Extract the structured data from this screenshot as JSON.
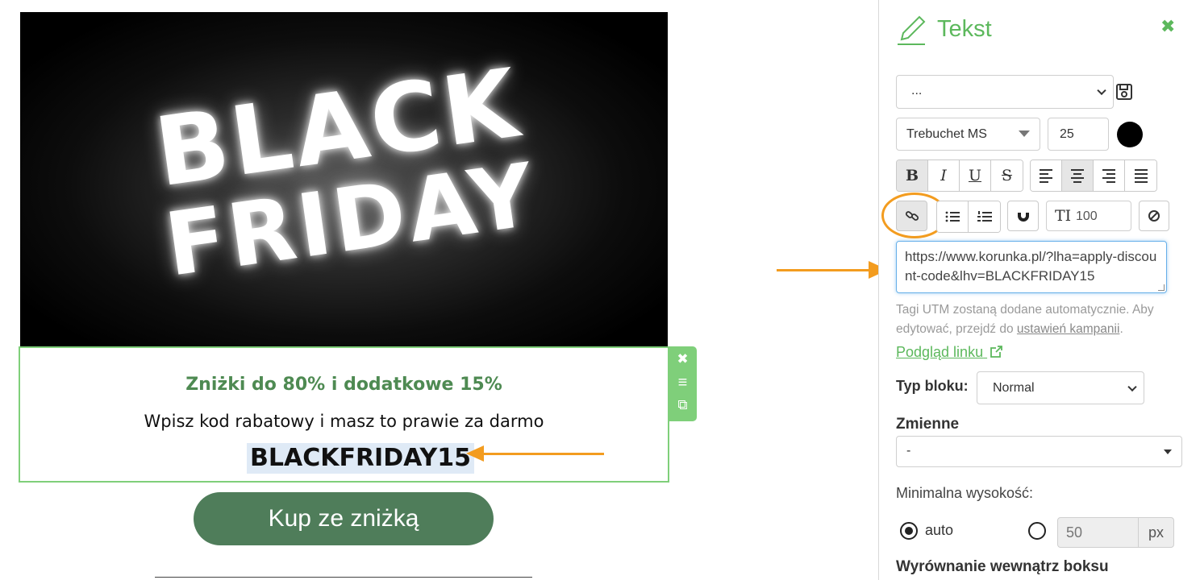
{
  "canvas": {
    "hero": {
      "line1": "BLACK",
      "line2": "FRIDAY"
    },
    "text_block": {
      "heading": "Zniżki do 80% i dodatkowe 15%",
      "subheading": "Wpisz kod rabatowy i masz to prawie za darmo",
      "code": "BLACKFRIDAY15"
    },
    "block_tools": {
      "close": "✖",
      "move": "≡",
      "duplicate": "⧉"
    },
    "cta_label": "Kup ze zniżką"
  },
  "panel": {
    "title": "Tekst",
    "close": "✖",
    "style_select": "...",
    "font_family": "Trebuchet MS",
    "font_size": "25",
    "text_color": "#000000",
    "format_buttons": {
      "bold": "B",
      "italic": "I",
      "underline": "U",
      "strike": "S"
    },
    "line_height_icon": "TI",
    "line_height": "100",
    "link_url": "https://www.korunka.pl/?lha=apply-discount-code&lhv=BLACKFRIDAY15",
    "utm_note_prefix": "Tagi UTM zostaną dodane automatycznie. Aby edytować, przejdź do ",
    "utm_note_link": "ustawień kampanii",
    "utm_note_suffix": ".",
    "preview_link": "Podgląd linku",
    "block_type_label": "Typ bloku:",
    "block_type_value": "Normal",
    "variables_label": "Zmienne",
    "variables_value": "-",
    "min_height_label": "Minimalna wysokość:",
    "min_height_auto": "auto",
    "min_height_value": "50",
    "min_height_unit": "px",
    "inner_align_label": "Wyrównanie wewnątrz boksu"
  },
  "colors": {
    "accent_green": "#5cb85c",
    "highlight_orange": "#f39c1f",
    "cta_green": "#4f7d5a"
  }
}
